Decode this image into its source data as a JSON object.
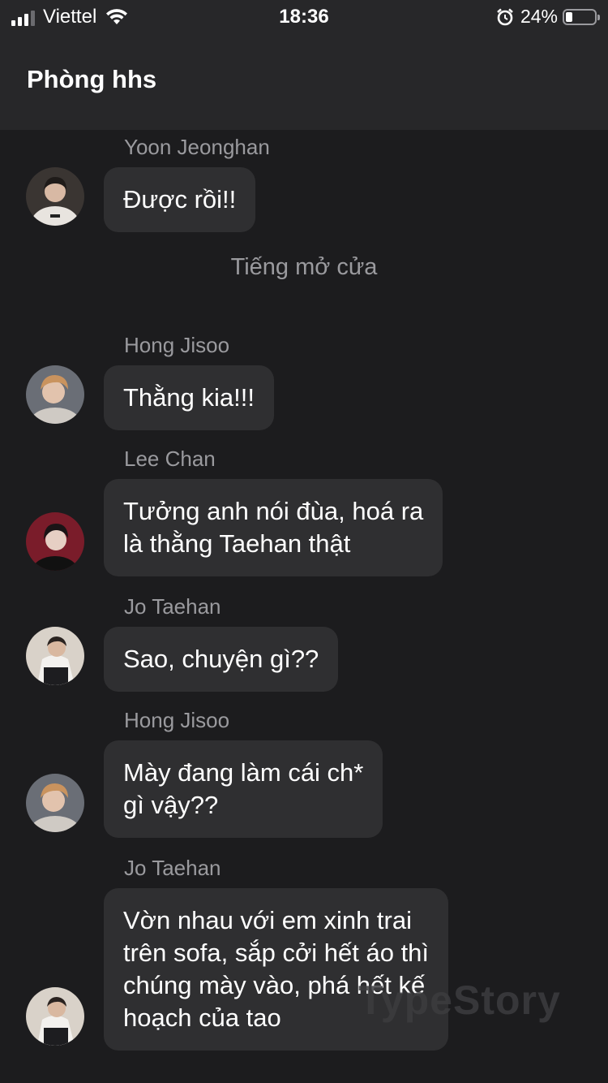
{
  "status_bar": {
    "carrier": "Viettel",
    "time": "18:36",
    "battery_percent": "24%",
    "battery_level": 0.24,
    "icons": [
      "signal-icon",
      "wifi-icon",
      "alarm-icon",
      "battery-icon"
    ]
  },
  "header": {
    "title": "Phòng hhs"
  },
  "messages": [
    {
      "sender": "Yoon Jeonghan",
      "text": "Được rồi!!",
      "avatar": "avatar-jeonghan"
    },
    {
      "system": "Tiếng mở cửa"
    },
    {
      "sender": "Hong Jisoo",
      "text": "Thằng kia!!!",
      "avatar": "avatar-jisoo"
    },
    {
      "sender": "Lee Chan",
      "text": "Tưởng anh nói đùa, hoá ra\nlà thằng Taehan thật",
      "avatar": "avatar-chan"
    },
    {
      "sender": "Jo Taehan",
      "text": "Sao, chuyện gì??",
      "avatar": "avatar-taehan"
    },
    {
      "sender": "Hong Jisoo",
      "text": "Mày đang làm cái ch*\ngì vậy??",
      "avatar": "avatar-jisoo"
    },
    {
      "sender": "Jo Taehan",
      "text": "Vờn nhau với em xinh trai\ntrên sofa, sắp cởi hết áo thì\nchúng mày vào, phá hết kế\nhoạch của tao",
      "avatar": "avatar-taehan"
    }
  ],
  "watermark": "TypeStory",
  "colors": {
    "background": "#1c1c1e",
    "header": "#272729",
    "bubble": "#2f2f31",
    "muted_text": "#9a9a9e"
  }
}
